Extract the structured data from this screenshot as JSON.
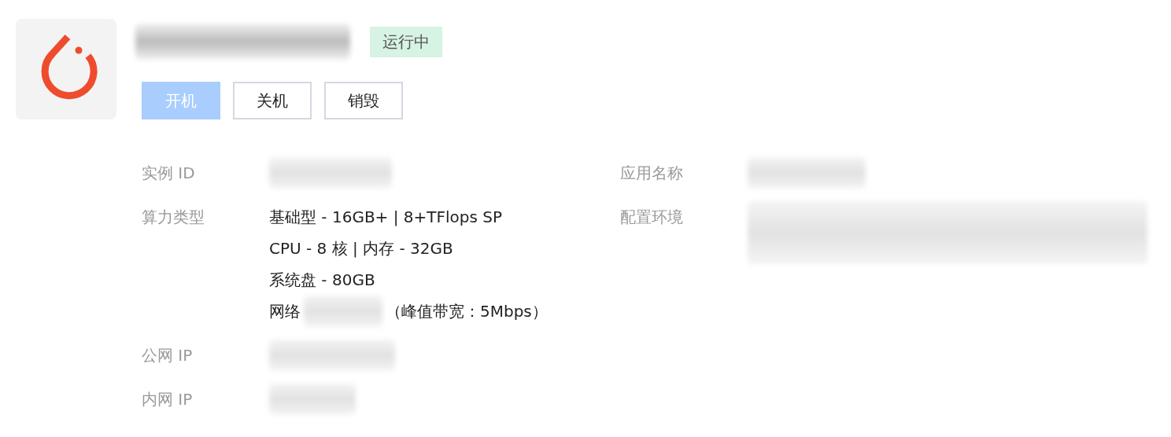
{
  "header": {
    "status": "运行中",
    "buttons": [
      {
        "label": "开机",
        "kind": "primary"
      },
      {
        "label": "关机",
        "kind": "default"
      },
      {
        "label": "销毁",
        "kind": "default"
      }
    ]
  },
  "details": {
    "left": [
      {
        "label": "实例 ID"
      },
      {
        "label": "算力类型",
        "lines": [
          "基础型 - 16GB+ | 8+TFlops SP",
          "CPU - 8 核 | 内存 - 32GB",
          "系统盘 - 80GB"
        ],
        "network": {
          "label": "网络",
          "peak": "（峰值带宽：5Mbps）"
        }
      },
      {
        "label": "公网 IP"
      },
      {
        "label": "内网 IP"
      }
    ],
    "right": [
      {
        "label": "应用名称"
      },
      {
        "label": "配置环境"
      }
    ]
  }
}
